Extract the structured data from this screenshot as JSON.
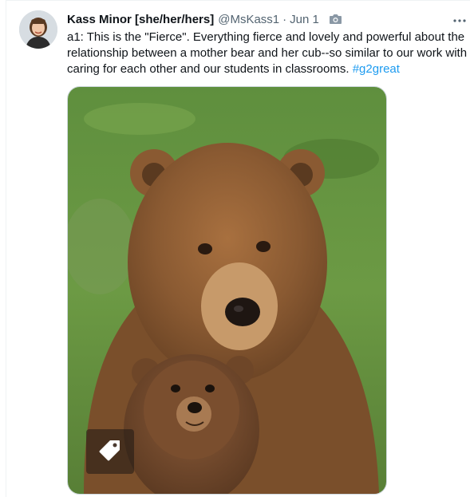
{
  "tweet": {
    "author_name": "Kass Minor [she/her/hers]",
    "handle": "@MsKass1",
    "separator": "·",
    "date": "Jun 1",
    "text": "a1: This is the \"Fierce\". Everything fierce and lovely and powerful about the relationship between a mother bear and her cub--so similar to our work with caring for each other and our students in classrooms.",
    "hashtag": "#g2great"
  },
  "icons": {
    "header_badge": "camera-icon",
    "more": "more-dots-icon",
    "media_overlay": "tag-icon"
  },
  "colors": {
    "text": "#0f1419",
    "secondary_text": "#536471",
    "link": "#1d9bf0",
    "border": "#cfd9de"
  }
}
